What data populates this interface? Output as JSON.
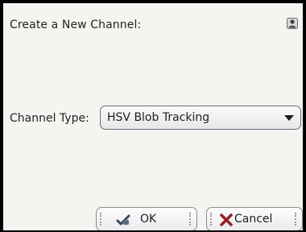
{
  "dialog": {
    "title": "Create a New Channel:",
    "title_icon": "user-icon"
  },
  "channel_type": {
    "label": "Channel Type:",
    "selected": "HSV Blob Tracking"
  },
  "buttons": {
    "ok_label": "OK",
    "ok_icon": "ok-check-icon",
    "cancel_label": "Cancel",
    "cancel_icon": "cancel-x-icon"
  },
  "colors": {
    "background": "#f6f4f1",
    "text": "#232325",
    "cancel_icon": "#9b1f1f",
    "ok_icon": "#3f4a55"
  }
}
